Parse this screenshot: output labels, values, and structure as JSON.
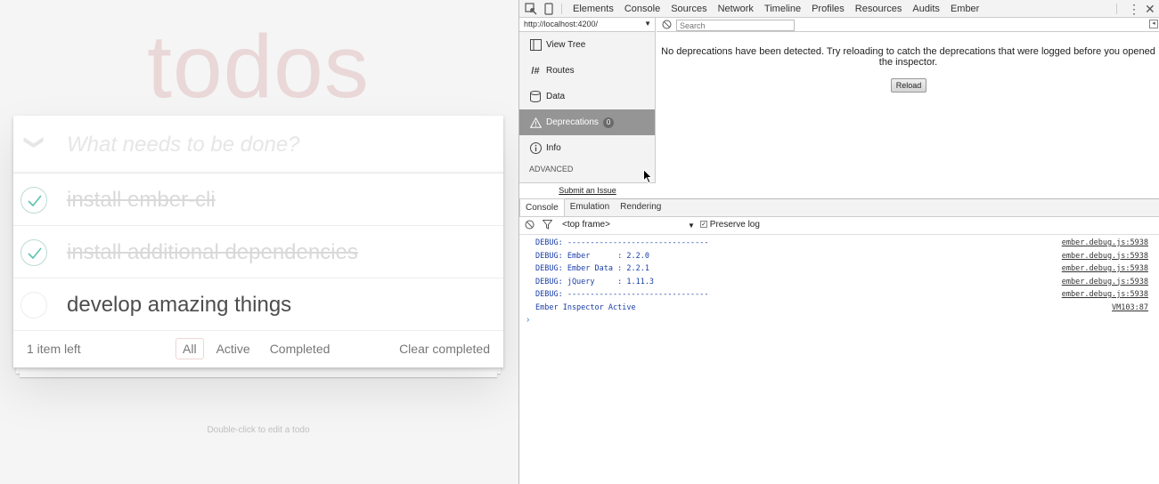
{
  "todo": {
    "title": "todos",
    "new_placeholder": "What needs to be done?",
    "toggle_all_glyph": "❯",
    "items": [
      {
        "label": "install ember-cli",
        "completed": true
      },
      {
        "label": "install additional dependencies",
        "completed": true
      },
      {
        "label": "develop amazing things",
        "completed": false
      }
    ],
    "count": "1 item left",
    "filters": [
      "All",
      "Active",
      "Completed"
    ],
    "selected_filter": "All",
    "clear": "Clear completed",
    "info": "Double-click to edit a todo",
    "colors": {
      "title": "#af2f2f",
      "check": "#5dc2af"
    }
  },
  "devtools": {
    "tabs": [
      "Elements",
      "Console",
      "Sources",
      "Network",
      "Timeline",
      "Profiles",
      "Resources",
      "Audits",
      "Ember"
    ],
    "url": "http://localhost:4200/",
    "search_placeholder": "Search",
    "sidebar": [
      {
        "label": "View Tree",
        "icon": "view-tree-icon"
      },
      {
        "label": "Routes",
        "icon": "routes-icon"
      },
      {
        "label": "Data",
        "icon": "database-icon"
      },
      {
        "label": "Deprecations",
        "icon": "warning-icon",
        "badge": "0",
        "active": true
      },
      {
        "label": "Info",
        "icon": "info-icon"
      }
    ],
    "advanced": "ADVANCED",
    "submit_issue": "Submit an Issue",
    "no_deprecations": "No deprecations have been detected. Try reloading to catch the deprecations that were logged before you opened the inspector.",
    "reload": "Reload",
    "drawer_tabs": [
      "Console",
      "Emulation",
      "Rendering"
    ],
    "frame": "<top frame>",
    "preserve_log": "Preserve log",
    "console": [
      {
        "text": "DEBUG: -------------------------------",
        "src": "ember.debug.js:5938"
      },
      {
        "text": "DEBUG: Ember      : 2.2.0",
        "src": "ember.debug.js:5938"
      },
      {
        "text": "DEBUG: Ember Data : 2.2.1",
        "src": "ember.debug.js:5938"
      },
      {
        "text": "DEBUG: jQuery     : 1.11.3",
        "src": "ember.debug.js:5938"
      },
      {
        "text": "DEBUG: -------------------------------",
        "src": "ember.debug.js:5938"
      },
      {
        "text": "Ember Inspector Active",
        "src": "VM103:87"
      }
    ],
    "prompt": "›"
  }
}
